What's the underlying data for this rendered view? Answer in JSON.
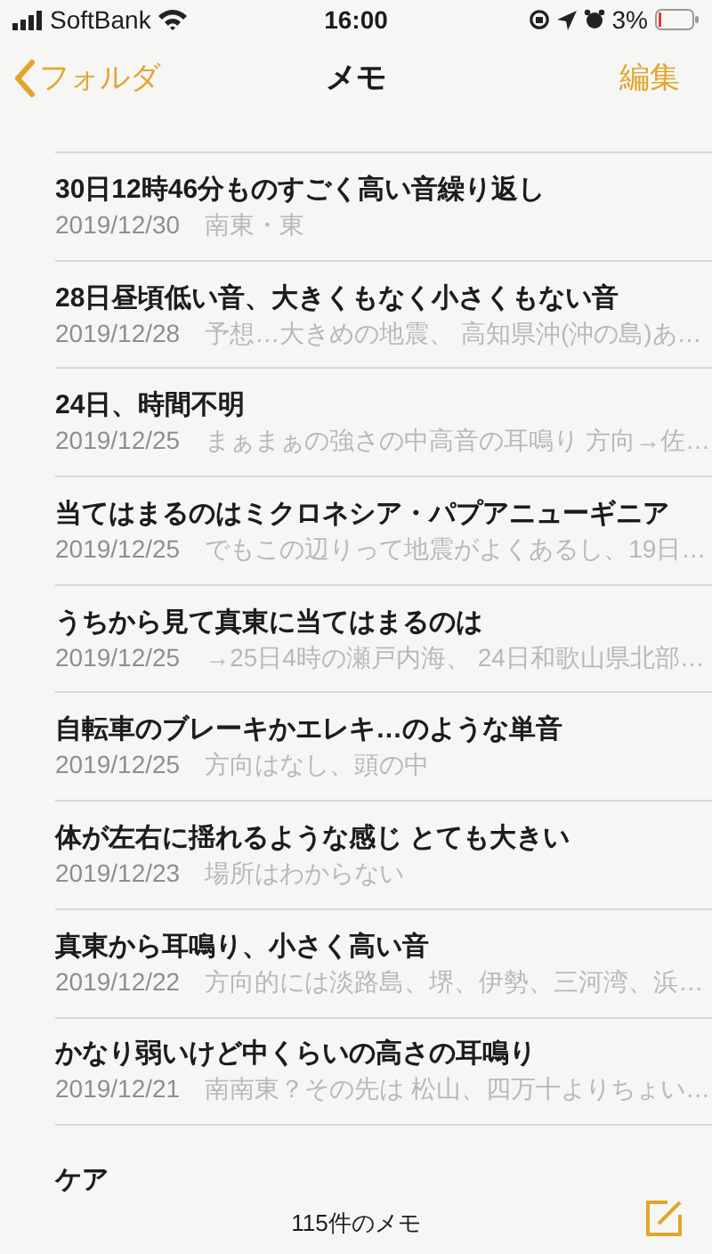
{
  "status_bar": {
    "carrier": "SoftBank",
    "time": "16:00",
    "battery": "3%"
  },
  "nav": {
    "back": "フォルダ",
    "title": "メモ",
    "edit": "編集"
  },
  "notes": [
    {
      "title": "30日12時46分ものすごく高い音繰り返し",
      "date": "2019/12/30",
      "preview": "南東・東"
    },
    {
      "title": "28日昼頃低い音、大きくもなく小さくもない音",
      "date": "2019/12/28",
      "preview": "予想…大きめの地震、 高知県沖(沖の島)あ…"
    },
    {
      "title": "24日、時間不明",
      "date": "2019/12/25",
      "preview": "まぁまぁの強さの中高音の耳鳴り 方向→佐…"
    },
    {
      "title": "当てはまるのはミクロネシア・パプアニューギニア",
      "date": "2019/12/25",
      "preview": "でもこの辺りって地震がよくあるし、19日…"
    },
    {
      "title": "うちから見て真東に当てはまるのは",
      "date": "2019/12/25",
      "preview": "→25日4時の瀬戸内海、 24日和歌山県北部…"
    },
    {
      "title": "自転車のブレーキかエレキ…のような単音",
      "date": "2019/12/25",
      "preview": "方向はなし、頭の中"
    },
    {
      "title": "体が左右に揺れるような感じ とても大きい",
      "date": "2019/12/23",
      "preview": "場所はわからない"
    },
    {
      "title": "真東から耳鳴り、小さく高い音",
      "date": "2019/12/22",
      "preview": "方向的には淡路島、堺、伊勢、三河湾、浜…"
    },
    {
      "title": "かなり弱いけど中くらいの高さの耳鳴り",
      "date": "2019/12/21",
      "preview": "南南東？その先は 松山、四万十よりちょい…"
    },
    {
      "title": "ケア"
    }
  ],
  "toolbar": {
    "count": "115件のメモ"
  }
}
